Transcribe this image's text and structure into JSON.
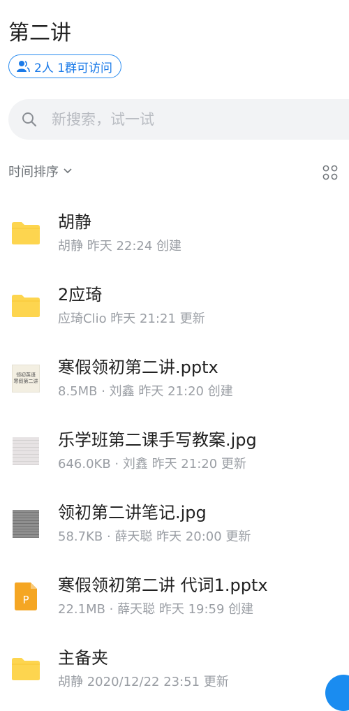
{
  "page": {
    "title": "第二讲"
  },
  "access": {
    "label": "2人 1群可访问",
    "icon": "people-icon",
    "color": "#1a7ae8"
  },
  "search": {
    "placeholder": "新搜索，试一试",
    "icon": "search-icon"
  },
  "sort": {
    "label": "时间排序",
    "icon": "chevron-down-icon"
  },
  "view_toggle": {
    "icon": "grid-view-icon"
  },
  "files": [
    {
      "name": "胡静",
      "meta": "胡静 昨天 22:24 创建",
      "type": "folder"
    },
    {
      "name": "2应琦",
      "meta": "应琦Clio 昨天 21:21 更新",
      "type": "folder"
    },
    {
      "name": "寒假领初第二讲.pptx",
      "meta": "8.5MB · 刘鑫 昨天 21:20 创建",
      "type": "pptx-thumb",
      "thumb_text": [
        "领初英语",
        "寒假第二讲"
      ]
    },
    {
      "name": "乐学班第二课手写教案.jpg",
      "meta": "646.0KB · 刘鑫 昨天 21:20 更新",
      "type": "image"
    },
    {
      "name": "领初第二讲笔记.jpg",
      "meta": "58.7KB · 薛天聪 昨天 20:00 更新",
      "type": "image-dark"
    },
    {
      "name": "寒假领初第二讲 代词1.pptx",
      "meta": "22.1MB · 薛天聪 昨天 19:59 创建",
      "type": "pptx-icon",
      "icon_letter": "P"
    },
    {
      "name": "主备夹",
      "meta": "胡静 2020/12/22 23:51 更新",
      "type": "folder"
    }
  ],
  "colors": {
    "accent": "#1a8cf0",
    "folder": "#fdd54f",
    "pptx": "#f5a623"
  }
}
